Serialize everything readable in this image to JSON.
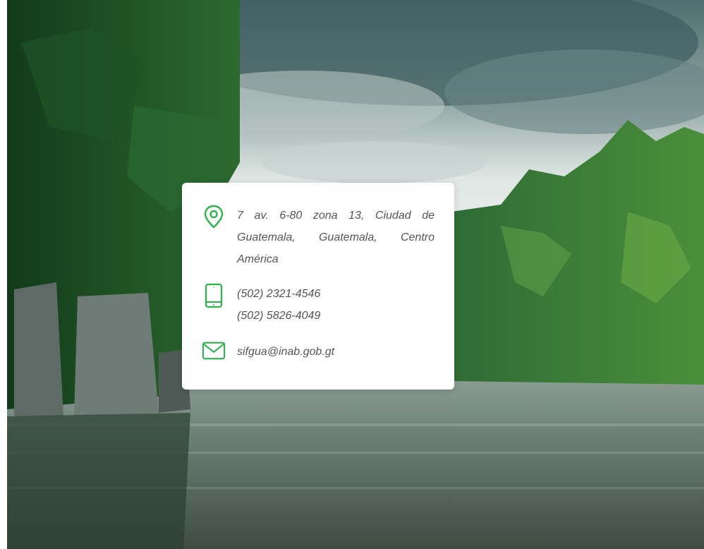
{
  "contact": {
    "address": "7 av. 6-80 zona 13, Ciudad de Guatemala, Guatemala, Centro América",
    "phone_1": "(502) 2321-4546",
    "phone_2": "(502) 5826-4049",
    "email": "sifgua@inab.gob.gt"
  },
  "icons": {
    "location": "map-pin-icon",
    "phone": "mobile-phone-icon",
    "email": "envelope-icon"
  },
  "colors": {
    "accent": "#2bb34a",
    "card_background": "#ffffff",
    "text": "#555555"
  }
}
